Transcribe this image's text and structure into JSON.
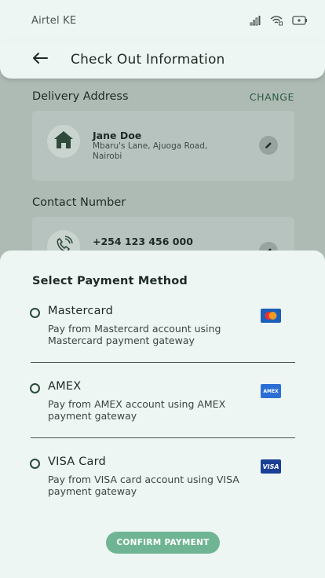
{
  "status_bar": {
    "carrier": "Airtel KE",
    "icons": [
      "signal-icon",
      "wifi-icon",
      "battery-icon"
    ]
  },
  "header": {
    "back_icon": "arrow-left-icon",
    "title": "Check Out Information"
  },
  "delivery": {
    "section_title": "Delivery Address",
    "change_label": "CHANGE",
    "name": "Jane Doe",
    "address_line1": "Mbaru's Lane, Ajuoga Road,",
    "address_line2": "Nairobi",
    "icon": "home-icon",
    "edit_icon": "pencil-icon"
  },
  "contact": {
    "section_title": "Contact Number",
    "phone": "+254 123 456 000",
    "icon": "phone-icon",
    "edit_icon": "pencil-icon"
  },
  "payment": {
    "title": "Select Payment Method",
    "options": [
      {
        "name": "Mastercard",
        "description": "Pay from Mastercard account using Mastercard payment gateway",
        "logo": "mastercard-logo",
        "selected": false
      },
      {
        "name": "AMEX",
        "description": "Pay from AMEX account using AMEX payment gateway",
        "logo": "amex-logo",
        "logo_text": "AMEX",
        "selected": false
      },
      {
        "name": "VISA Card",
        "description": "Pay from VISA card account using VISA payment gateway",
        "logo": "visa-logo",
        "logo_text": "VISA",
        "selected": false
      }
    ],
    "confirm_label": "CONFIRM PAYMENT"
  },
  "colors": {
    "accent": "#6fb593",
    "sheet_bg": "#edf6f3",
    "overlay": "#aebbb5",
    "change_link": "#2f5a44"
  }
}
